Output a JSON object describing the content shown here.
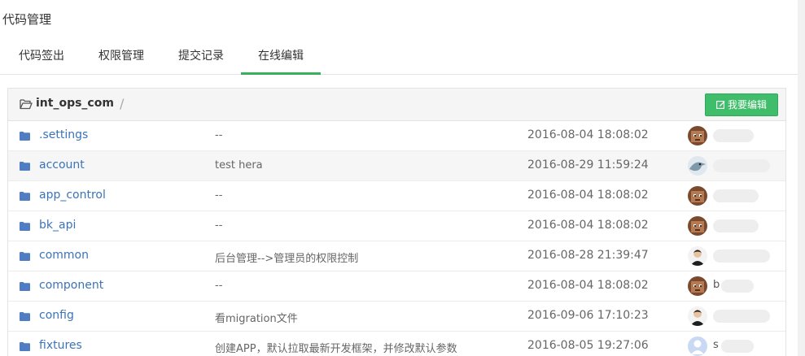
{
  "header": {
    "title": "代码管理"
  },
  "tabs": [
    {
      "label": "代码签出",
      "active": false
    },
    {
      "label": "权限管理",
      "active": false
    },
    {
      "label": "提交记录",
      "active": false
    },
    {
      "label": "在线编辑",
      "active": true
    }
  ],
  "repo": {
    "name": "int_ops_com",
    "separator": "/",
    "edit_button_label": "我要编辑"
  },
  "colors": {
    "accent_green": "#39b15a",
    "link_blue": "#3b73b9"
  },
  "files": [
    {
      "name": ".settings",
      "message": "--",
      "time": "2016-08-04 18:08:02",
      "author": "",
      "avatar": "brown-face-avatar"
    },
    {
      "name": "account",
      "message": "test hera",
      "time": "2016-08-29 11:59:24",
      "author": "",
      "avatar": "bird-avatar"
    },
    {
      "name": "app_control",
      "message": "--",
      "time": "2016-08-04 18:08:02",
      "author": "",
      "avatar": "brown-face-avatar"
    },
    {
      "name": "bk_api",
      "message": "--",
      "time": "2016-08-04 18:08:02",
      "author": "",
      "avatar": "brown-face-avatar"
    },
    {
      "name": "common",
      "message": "后台管理-->管理员的权限控制",
      "time": "2016-08-28 21:39:47",
      "author": "",
      "avatar": "person-avatar"
    },
    {
      "name": "component",
      "message": "--",
      "time": "2016-08-04 18:08:02",
      "author": "b",
      "avatar": "brown-face-avatar"
    },
    {
      "name": "config",
      "message": "看migration文件",
      "time": "2016-09-06 17:10:23",
      "author": "",
      "avatar": "person-avatar"
    },
    {
      "name": "fixtures",
      "message": "创建APP，默认拉取最新开发框架，并修改默认参数",
      "time": "2016-08-05 19:27:06",
      "author": "s",
      "avatar": "default-user-avatar"
    }
  ]
}
